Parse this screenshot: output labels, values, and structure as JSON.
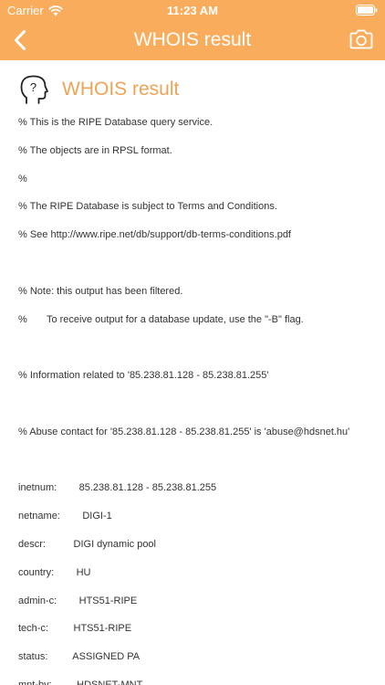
{
  "status_bar": {
    "carrier": "Carrier",
    "time": "11:23 AM"
  },
  "nav": {
    "title": "WHOIS result",
    "back_icon": "chevron-left-icon",
    "camera_icon": "camera-icon"
  },
  "result": {
    "title": "WHOIS result",
    "icon": "question-head-icon",
    "lines": [
      "% This is the RIPE Database query service.",
      "% The objects are in RPSL format.",
      "%",
      "% The RIPE Database is subject to Terms and Conditions.",
      "% See http://www.ripe.net/db/support/db-terms-conditions.pdf",
      "",
      "% Note: this output has been filtered.",
      "%       To receive output for a database update, use the \"-B\" flag.",
      "",
      "% Information related to '85.238.81.128 - 85.238.81.255'",
      "",
      "% Abuse contact for '85.238.81.128 - 85.238.81.255' is 'abuse@hdsnet.hu'",
      "",
      "inetnum:        85.238.81.128 - 85.238.81.255",
      "netname:        DIGI-1",
      "descr:          DIGI dynamic pool",
      "country:        HU",
      "admin-c:        HTS51-RIPE",
      "tech-c:         HTS51-RIPE",
      "status:         ASSIGNED PA",
      "mnt-by:         HDSNET-MNT"
    ]
  },
  "colors": {
    "accent": "#f9ad5c",
    "title_text": "#f0a356",
    "body_text": "#333333"
  }
}
